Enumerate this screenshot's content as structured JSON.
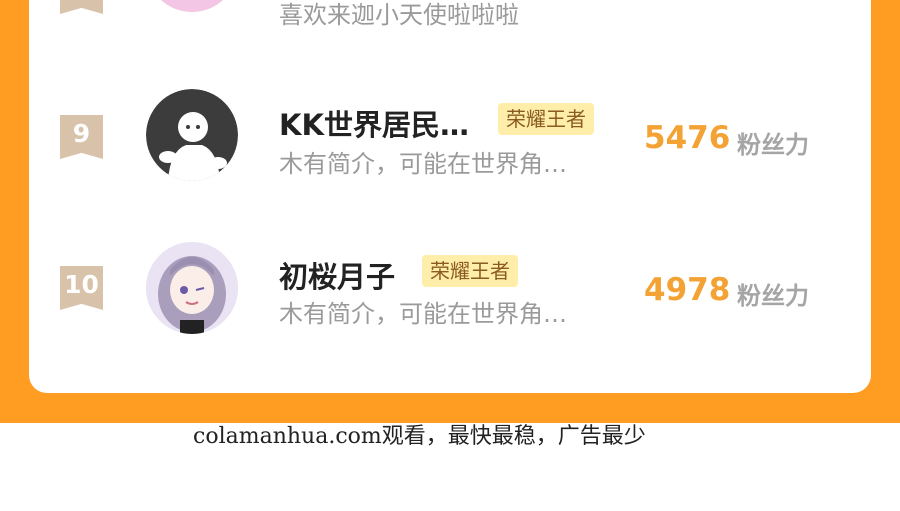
{
  "previous_row": {
    "desc": "喜欢来迦小天使啦啦啦"
  },
  "rows": [
    {
      "rank": "9",
      "name": "KK世界居民…",
      "badge": "荣耀王者",
      "desc": "木有简介，可能在世界角…",
      "score": "5476",
      "score_label": "粉丝力"
    },
    {
      "rank": "10",
      "name": "初桜月子",
      "badge": "荣耀王者",
      "desc": "木有简介，可能在世界角…",
      "score": "4978",
      "score_label": "粉丝力"
    }
  ],
  "watermark": "colamanhua.com观看，最快最稳，广告最少",
  "colors": {
    "background_orange": "#ff9d23",
    "score_orange": "#f3a233",
    "badge_bg": "#ffedaa",
    "badge_text": "#8a5b22"
  }
}
